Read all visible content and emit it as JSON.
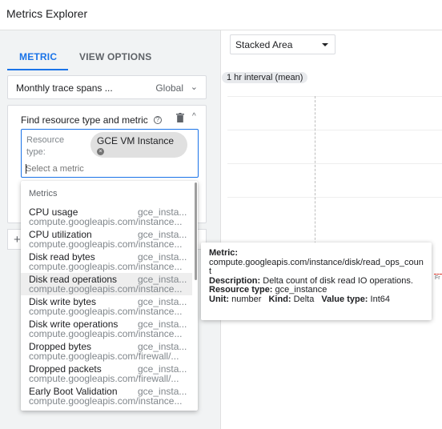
{
  "app": {
    "title": "Metrics Explorer"
  },
  "tabs": [
    {
      "label": "METRIC"
    },
    {
      "label": "VIEW OPTIONS"
    }
  ],
  "trace_selector": {
    "label": "Monthly trace spans ...",
    "value": "Global"
  },
  "find_panel": {
    "title": "Find resource type and metric",
    "resource_label": "Resource type:",
    "resource_chip": "GCE VM Instance",
    "metric_placeholder": "Select a metric"
  },
  "metrics_dropdown": {
    "header": "Metrics",
    "items": [
      {
        "name": "CPU usage",
        "type": "gce_insta...",
        "path": "compute.googleapis.com/instance..."
      },
      {
        "name": "CPU utilization",
        "type": "gce_insta...",
        "path": "compute.googleapis.com/instance..."
      },
      {
        "name": "Disk read bytes",
        "type": "gce_insta...",
        "path": "compute.googleapis.com/instance..."
      },
      {
        "name": "Disk read operations",
        "type": "gce_insta...",
        "path": "compute.googleapis.com/instance..."
      },
      {
        "name": "Disk write bytes",
        "type": "gce_insta...",
        "path": "compute.googleapis.com/instance..."
      },
      {
        "name": "Disk write operations",
        "type": "gce_insta...",
        "path": "compute.googleapis.com/instance..."
      },
      {
        "name": "Dropped bytes",
        "type": "gce_insta...",
        "path": "compute.googleapis.com/firewall/..."
      },
      {
        "name": "Dropped packets",
        "type": "gce_insta...",
        "path": "compute.googleapis.com/firewall/..."
      },
      {
        "name": "Early Boot Validation",
        "type": "gce_insta...",
        "path": "compute.googleapis.com/instance..."
      }
    ],
    "highlighted_index": 3
  },
  "chart": {
    "type_select": "Stacked Area",
    "interval": "1 hr interval (mean)",
    "edge_label": "Fr"
  },
  "tooltip": {
    "metric_label": "Metric:",
    "metric_value": "compute.googleapis.com/instance/disk/read_ops_count",
    "description_label": "Description:",
    "description_value": "Delta count of disk read IO operations.",
    "resource_label": "Resource type:",
    "resource_value": "gce_instance",
    "unit_label": "Unit:",
    "unit_value": "number",
    "kind_label": "Kind:",
    "kind_value": "Delta",
    "value_type_label": "Value type:",
    "value_type_value": "Int64"
  },
  "colors": {
    "accent": "#1a73e8",
    "panel_bg": "#f1f3f4",
    "highlight": "#eeeeee"
  }
}
